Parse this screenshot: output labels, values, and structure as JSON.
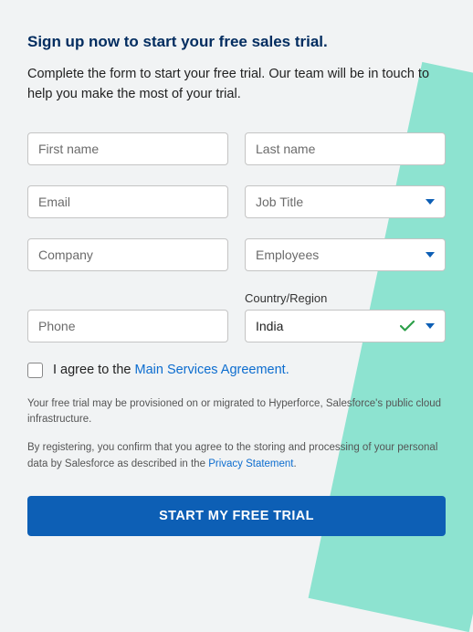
{
  "heading": "Sign up now to start your free sales trial.",
  "subheading": "Complete the form to start your free trial. Our team will be in touch to help you make the most of your trial.",
  "fields": {
    "first_name": {
      "placeholder": "First name"
    },
    "last_name": {
      "placeholder": "Last name"
    },
    "email": {
      "placeholder": "Email"
    },
    "job_title": {
      "placeholder": "Job Title"
    },
    "company": {
      "placeholder": "Company"
    },
    "employees": {
      "placeholder": "Employees"
    },
    "phone": {
      "placeholder": "Phone"
    },
    "country": {
      "label": "Country/Region",
      "value": "India"
    }
  },
  "agree": {
    "prefix": "I agree to the ",
    "link_text": "Main Services Agreement."
  },
  "fine1": "Your free trial may be provisioned on or migrated to Hyperforce, Salesforce's public cloud infrastructure.",
  "fine2_prefix": "By registering, you confirm that you agree to the storing and processing of your personal data by Salesforce as described in the ",
  "fine2_link": "Privacy Statement",
  "fine2_suffix": ".",
  "submit_label": "START MY FREE TRIAL"
}
